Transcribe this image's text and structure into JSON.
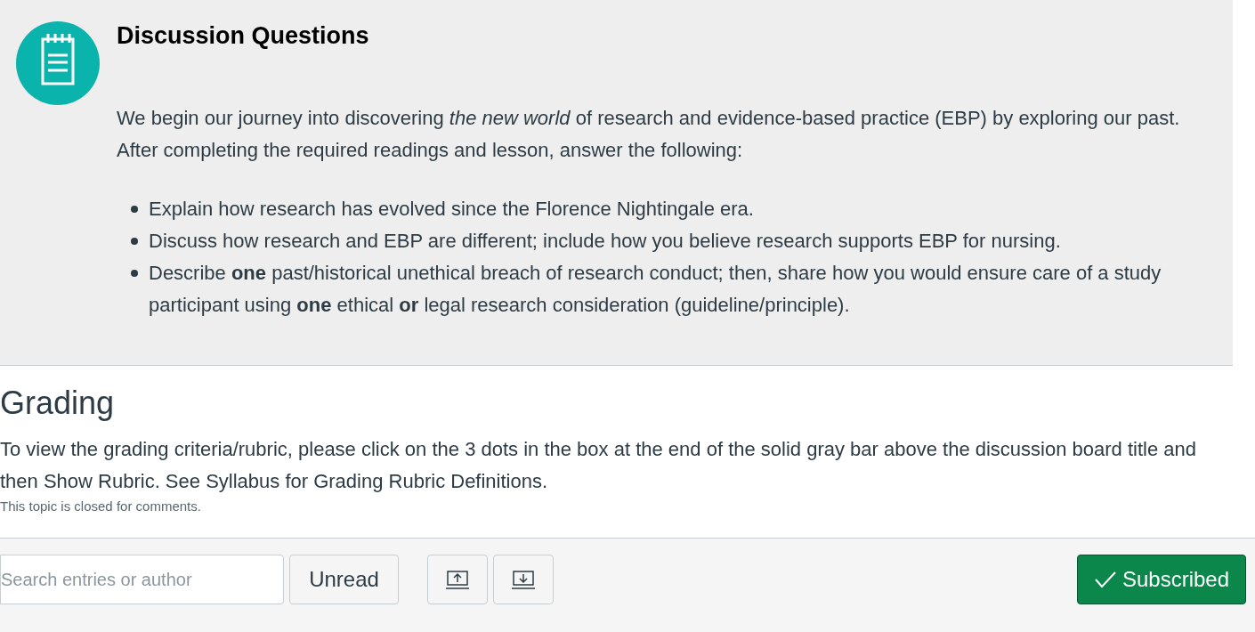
{
  "discussion": {
    "title": "Discussion Questions",
    "intro": "We begin our journey into discovering *the new world* of research and evidence-based practice (EBP) by exploring our past. After completing the required readings and lesson, answer the following:",
    "bullets": [
      "Explain how research has evolved since the Florence Nightingale era.",
      "Discuss how research and EBP are different; include how you believe research supports EBP for nursing.",
      "Describe **one** past/historical unethical breach of research conduct; then, share how you would ensure care of a study participant using **one** ethical **or** legal research consideration (guideline/principle)."
    ]
  },
  "grading": {
    "heading": "Grading",
    "text": "To view the grading criteria/rubric, please click on the 3 dots in the box at the end of the solid gray bar above the discussion board title and then Show Rubric. See Syllabus for Grading Rubric Definitions.",
    "note": "This topic is closed for comments."
  },
  "toolbar": {
    "search": {
      "placeholder": "Search entries or author"
    },
    "unread_button": "Unread",
    "subscribe_button": {
      "label": "Subscribed",
      "subscribed": true
    }
  }
}
